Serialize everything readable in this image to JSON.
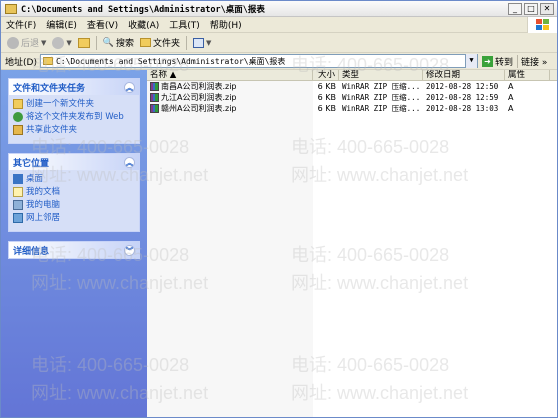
{
  "window": {
    "title": "C:\\Documents and Settings\\Administrator\\桌面\\报表"
  },
  "menu": [
    "文件(F)",
    "编辑(E)",
    "查看(V)",
    "收藏(A)",
    "工具(T)",
    "帮助(H)"
  ],
  "toolbar": {
    "back": "后退",
    "search": "搜索",
    "folders": "文件夹"
  },
  "address": {
    "label": "地址(D)",
    "value": "C:\\Documents and Settings\\Administrator\\桌面\\报表",
    "go": "转到",
    "links": "链接"
  },
  "tasks": {
    "file_tasks": {
      "title": "文件和文件夹任务",
      "items": [
        "创建一个新文件夹",
        "将这个文件夹发布到 Web",
        "共享此文件夹"
      ]
    },
    "other_places": {
      "title": "其它位置",
      "items": [
        "桌面",
        "我的文档",
        "我的电脑",
        "网上邻居"
      ]
    },
    "details": {
      "title": "详细信息"
    }
  },
  "columns": {
    "name": "名称",
    "size": "大小",
    "type": "类型",
    "date": "修改日期",
    "attr": "属性"
  },
  "files": [
    {
      "name": "南昌A公司利润表.zip",
      "size": "6 KB",
      "type": "WinRAR ZIP 压缩...",
      "date": "2012-08-28 12:50",
      "attr": "A"
    },
    {
      "name": "九江A公司利润表.zip",
      "size": "6 KB",
      "type": "WinRAR ZIP 压缩...",
      "date": "2012-08-28 12:59",
      "attr": "A"
    },
    {
      "name": "赣州A公司利润表.zip",
      "size": "6 KB",
      "type": "WinRAR ZIP 压缩...",
      "date": "2012-08-28 13:03",
      "attr": "A"
    }
  ],
  "watermark": {
    "phone": "电话: 400-665-0028",
    "web": "网址: www.chanjet.net"
  }
}
